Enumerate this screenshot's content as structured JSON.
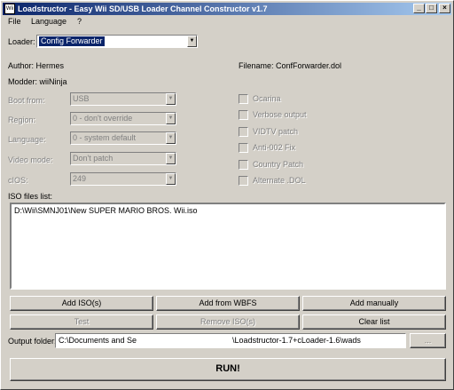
{
  "window": {
    "title": "Loadstructor - Easy Wii SD/USB Loader Channel Constructor v1.7",
    "icon_text": "Wii"
  },
  "menu": {
    "file": "File",
    "language": "Language",
    "help": "?"
  },
  "loader": {
    "label": "Loader:",
    "value": "Config Forwarder"
  },
  "info": {
    "author": "Author: Hermes",
    "modder": "Modder: wiiNinja",
    "filename": "Filename: ConfForwarder.dol"
  },
  "options": {
    "boot_from": {
      "label": "Boot from:",
      "value": "USB"
    },
    "region": {
      "label": "Region:",
      "value": "0 - don't override"
    },
    "language": {
      "label": "Language:",
      "value": "0 - system default"
    },
    "video_mode": {
      "label": "Video mode:",
      "value": "Don't patch"
    },
    "cios": {
      "label": "cIOS:",
      "value": "249"
    }
  },
  "checkboxes": {
    "ocarina": "Ocarina",
    "verbose": "Verbose output",
    "vidtv": "VIDTV patch",
    "anti002": "Anti-002 Fix",
    "country": "Country Patch",
    "alternate": "Alternate .DOL"
  },
  "iso": {
    "label": "ISO files list:",
    "items": [
      "D:\\Wii\\SMNJ01\\New SUPER MARIO BROS. Wii.iso"
    ]
  },
  "buttons": {
    "add_iso": "Add ISO(s)",
    "add_wbfs": "Add from WBFS",
    "add_manual": "Add manually",
    "test": "Test",
    "remove_iso": "Remove ISO(s)",
    "clear_list": "Clear list",
    "browse": "...",
    "run": "RUN!"
  },
  "output": {
    "label": "Output folder:",
    "path_start": "C:\\Documents and Se",
    "path_end": "\\Loadstructor-1.7+cLoader-1.6\\wads"
  },
  "colors": {
    "title_start": "#0a246a",
    "title_end": "#a6caf0",
    "face": "#d4d0c8",
    "disabled_text": "#808080"
  }
}
